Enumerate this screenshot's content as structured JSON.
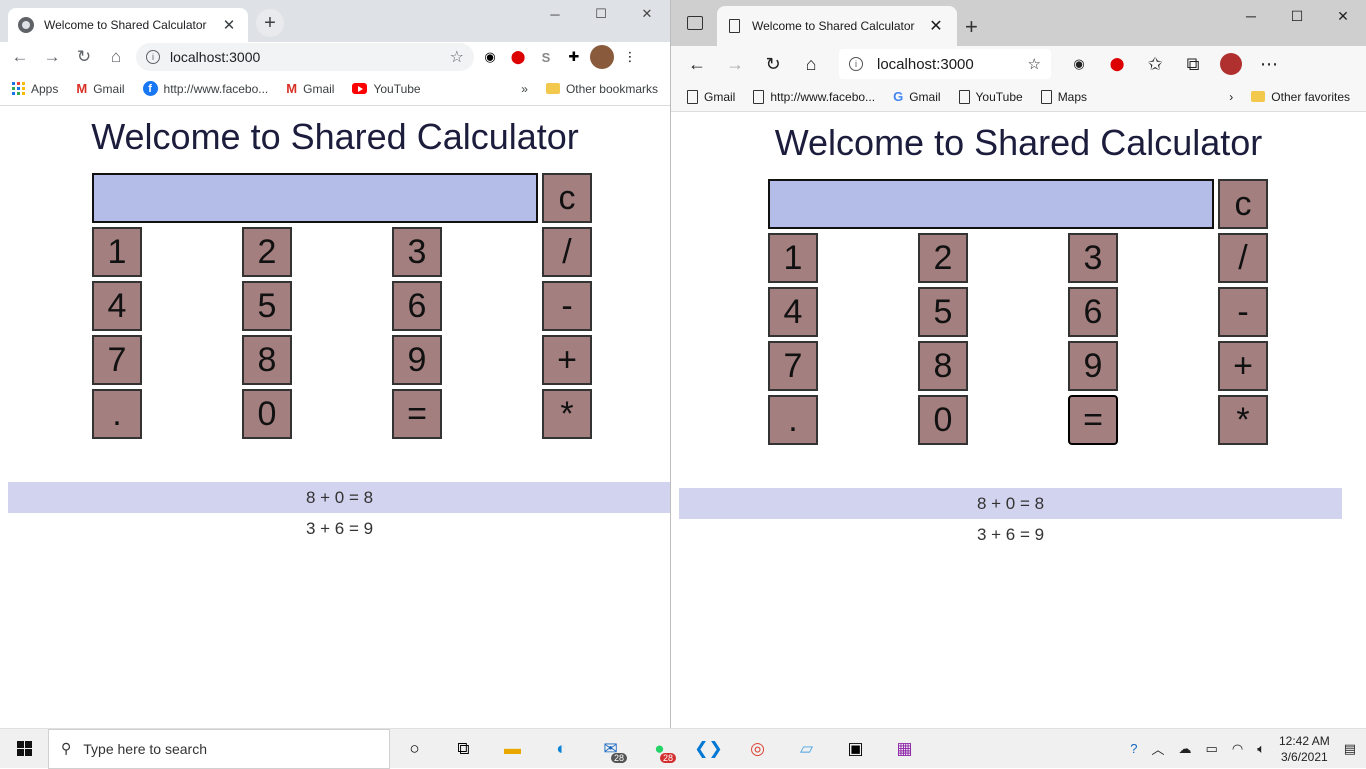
{
  "page": {
    "tab_title": "Welcome to Shared Calculator",
    "url": "localhost:3000",
    "heading": "Welcome to Shared Calculator"
  },
  "chrome": {
    "bookmarks": [
      "Apps",
      "Gmail",
      "http://www.facebo...",
      "Gmail",
      "YouTube"
    ],
    "overflow": "»",
    "other": "Other bookmarks"
  },
  "edge": {
    "bookmarks": [
      "Gmail",
      "http://www.facebo...",
      "Gmail",
      "YouTube",
      "Maps"
    ],
    "other": "Other favorites"
  },
  "calculator": {
    "display_value": "",
    "clear": "c",
    "keys": [
      [
        "1",
        "2",
        "3",
        "/"
      ],
      [
        "4",
        "5",
        "6",
        "-"
      ],
      [
        "7",
        "8",
        "9",
        "+"
      ],
      [
        ".",
        "0",
        "=",
        "*"
      ]
    ]
  },
  "history": [
    "8 + 0 = 8",
    "3 + 6 = 9"
  ],
  "taskbar": {
    "search_placeholder": "Type here to search",
    "mail_badge": "28",
    "whatsapp_badge": "28",
    "time": "12:42 AM",
    "date": "3/6/2021"
  },
  "colors": {
    "display_bg": "#b3bde8",
    "key_bg": "#a47f7f",
    "history_highlight": "#d2d3ef",
    "heading": "#1c1c3c"
  }
}
